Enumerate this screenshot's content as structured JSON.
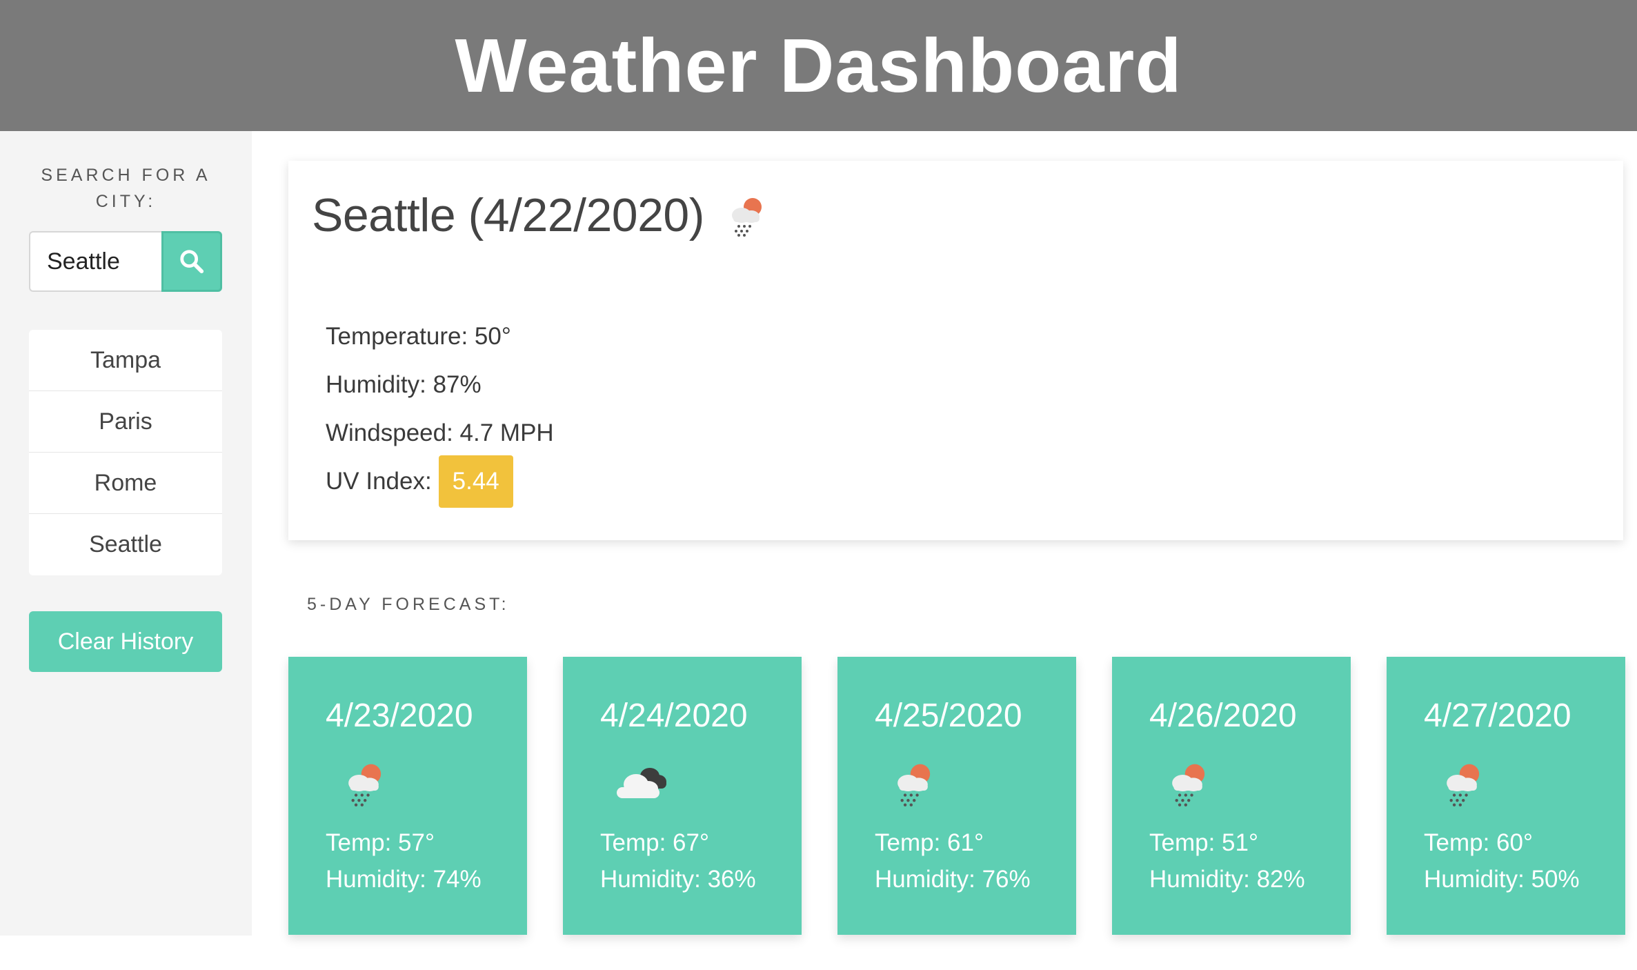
{
  "header": {
    "title": "Weather Dashboard"
  },
  "sidebar": {
    "search_label": "Search for a City:",
    "search_value": "Seattle",
    "search_icon": "search-icon",
    "history": [
      "Tampa",
      "Paris",
      "Rome",
      "Seattle"
    ],
    "clear_label": "Clear History"
  },
  "current": {
    "title": "Seattle (4/22/2020)",
    "icon": "rain-sun-icon",
    "temperature": "Temperature: 50°",
    "humidity": "Humidity: 87%",
    "windspeed": "Windspeed: 4.7 MPH",
    "uv_label": "UV Index:",
    "uv_value": "5.44"
  },
  "forecast": {
    "label": "5-DAY FORECAST:",
    "days": [
      {
        "date": "4/23/2020",
        "icon": "rain-sun-icon",
        "temp": "Temp: 57°",
        "humidity": "Humidity: 74%"
      },
      {
        "date": "4/24/2020",
        "icon": "broken-clouds-icon",
        "temp": "Temp: 67°",
        "humidity": "Humidity: 36%"
      },
      {
        "date": "4/25/2020",
        "icon": "rain-sun-icon",
        "temp": "Temp: 61°",
        "humidity": "Humidity: 76%"
      },
      {
        "date": "4/26/2020",
        "icon": "rain-sun-icon",
        "temp": "Temp: 51°",
        "humidity": "Humidity: 82%"
      },
      {
        "date": "4/27/2020",
        "icon": "rain-sun-icon",
        "temp": "Temp: 60°",
        "humidity": "Humidity: 50%"
      }
    ]
  },
  "colors": {
    "header_bg": "#7a7a7a",
    "accent": "#5ecfb3",
    "uv_badge": "#f2c23c",
    "sidebar_bg": "#f4f4f4"
  }
}
